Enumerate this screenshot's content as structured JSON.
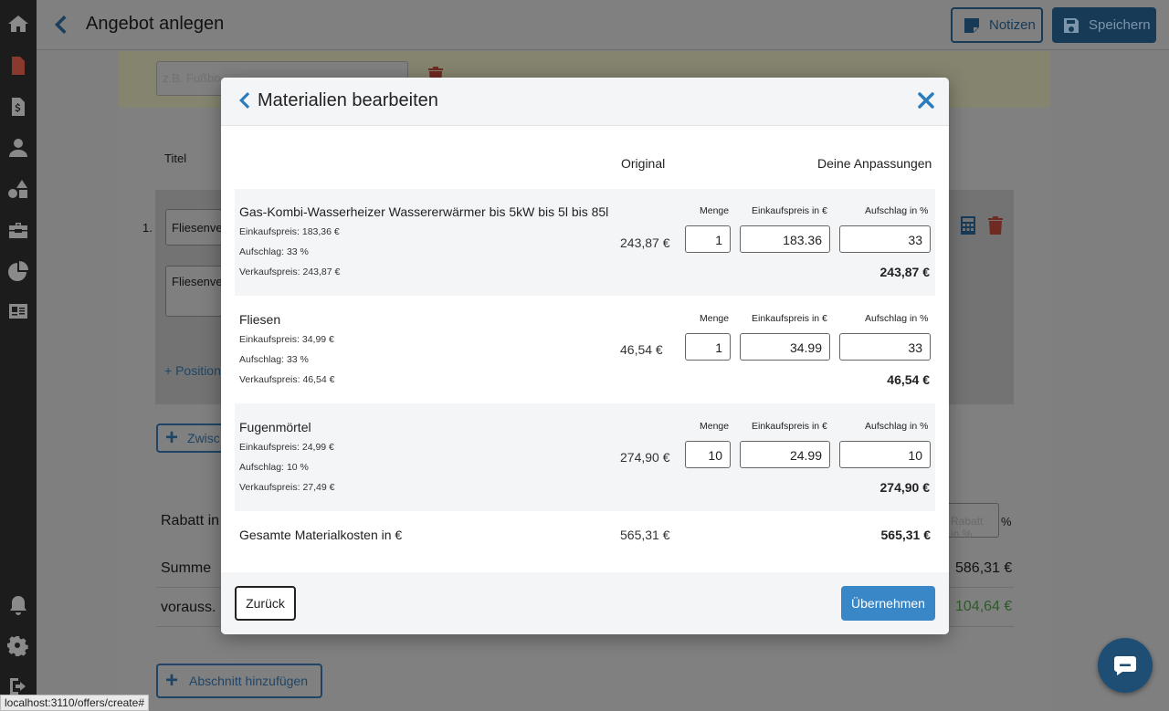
{
  "app": {
    "title": "Angebot anlegen",
    "notes_label": "Notizen",
    "save_label": "Speichern"
  },
  "background": {
    "search_placeholder": "z.B. Fußbo",
    "titel_label": "Titel",
    "position_number": "1.",
    "position_field_1": "Fliesenve",
    "position_field_2": "Fliesenve",
    "add_position_label": "+ Position",
    "zwischen_label": "Zwisc",
    "rabatt_label": "Rabatt in",
    "rabatt_placeholder": "Rabatt in %",
    "percent": "%",
    "summe_label": "Summe",
    "summe_value": "586,31 €",
    "voraus_label": "vorauss. P",
    "voraus_value": "104,64 €",
    "add_section_label": "Abschnitt hinzufügen"
  },
  "status_url": "localhost:3110/offers/create#",
  "modal": {
    "title": "Materialien bearbeiten",
    "col_original": "Original",
    "col_anpassungen": "Deine Anpassungen",
    "label_menge": "Menge",
    "label_einkauf": "Einkaufspreis in €",
    "label_aufschlag": "Aufschlag in %",
    "materials": [
      {
        "name": "Gas-Kombi-Wasserheizer Wassererwärmer bis 5kW bis 5l bis 85l",
        "einkauf": "Einkaufspreis: 183,36 €",
        "aufschlag": "Aufschlag: 33 %",
        "verkauf": "Verkaufspreis: 243,87 €",
        "original": "243,87 €",
        "menge": "1",
        "einkauf_input": "183.36",
        "aufschlag_input": "33",
        "total": "243,87 €"
      },
      {
        "name": "Fliesen",
        "einkauf": "Einkaufspreis: 34,99 €",
        "aufschlag": "Aufschlag: 33 %",
        "verkauf": "Verkaufspreis: 46,54 €",
        "original": "46,54 €",
        "menge": "1",
        "einkauf_input": "34.99",
        "aufschlag_input": "33",
        "total": "46,54 €"
      },
      {
        "name": "Fugenmörtel",
        "einkauf": "Einkaufspreis: 24,99 €",
        "aufschlag": "Aufschlag: 10 %",
        "verkauf": "Verkaufspreis: 27,49 €",
        "original": "274,90 €",
        "menge": "10",
        "einkauf_input": "24.99",
        "aufschlag_input": "10",
        "total": "274,90 €"
      }
    ],
    "sum_label": "Gesamte Materialkosten in €",
    "sum_original": "565,31 €",
    "sum_value": "565,31 €",
    "back_button": "Zurück",
    "apply_button": "Übernehmen"
  },
  "colors": {
    "accent": "#2b7bbd",
    "primary_dark": "#173a57",
    "danger": "#c0392b",
    "success": "#2d8a2a"
  }
}
